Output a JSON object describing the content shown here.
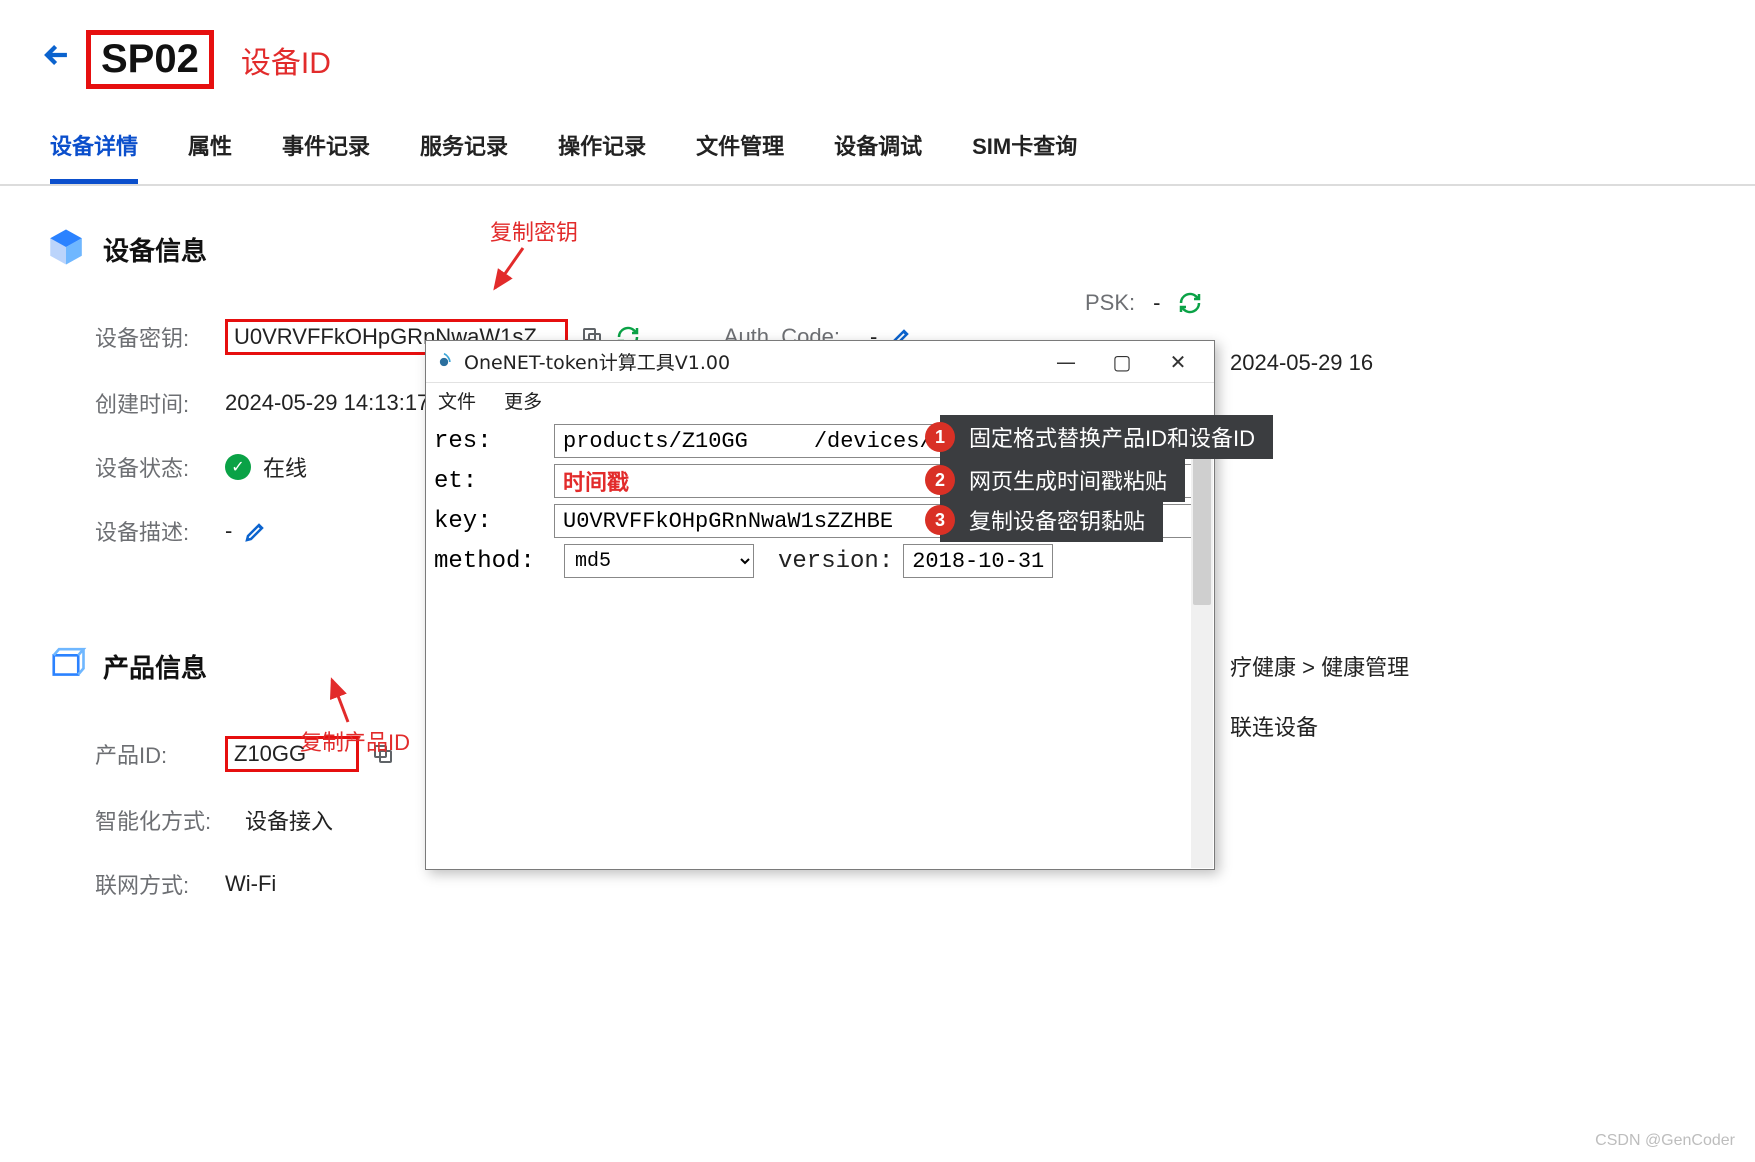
{
  "header": {
    "device_id": "SP02",
    "device_id_label": "设备ID"
  },
  "tabs": [
    "设备详情",
    "属性",
    "事件记录",
    "服务记录",
    "操作记录",
    "文件管理",
    "设备调试",
    "SIM卡查询"
  ],
  "device_info": {
    "title": "设备信息",
    "key_label": "设备密钥:",
    "key_value": "U0VRVFFkOHpGRnNwaW1sZ…",
    "auth_code_label": "Auth_Code:",
    "auth_code_value": "-",
    "psk_label": "PSK:",
    "psk_value": "-",
    "create_time_label": "创建时间:",
    "create_time_value": "2024-05-29 14:13:17",
    "right_time": "2024-05-29 16",
    "status_label": "设备状态:",
    "status_value": "在线",
    "desc_label": "设备描述:",
    "desc_value": "-"
  },
  "product_info": {
    "title": "产品信息",
    "id_label": "产品ID:",
    "id_value": "Z10GG  ",
    "breadcrumb_right": "疗健康 > 健康管理",
    "smart_label": "智能化方式:",
    "smart_value": "设备接入",
    "device_type_right": "联连设备",
    "net_label": "联网方式:",
    "net_value": "Wi-Fi"
  },
  "annotations": {
    "copy_key": "复制密钥",
    "copy_product_id": "复制产品ID"
  },
  "tool": {
    "title": "OneNET-token计算工具V1.00",
    "menu": [
      "文件",
      "更多"
    ],
    "res_label": "res:",
    "res_value": "products/Z10GG   /devices/SP02",
    "et_label": "et:",
    "et_placeholder": "时间戳",
    "key_label": "key:",
    "key_value": "U0VRVFFkOHpGRnNwaW1sZZHBE  ",
    "method_label": "method:",
    "method_value": "md5",
    "version_label": "version:",
    "version_value": "2018-10-31"
  },
  "callouts": [
    "固定格式替换产品ID和设备ID",
    "网页生成时间戳粘贴",
    "复制设备密钥黏贴"
  ],
  "watermark": "CSDN @GenCoder"
}
